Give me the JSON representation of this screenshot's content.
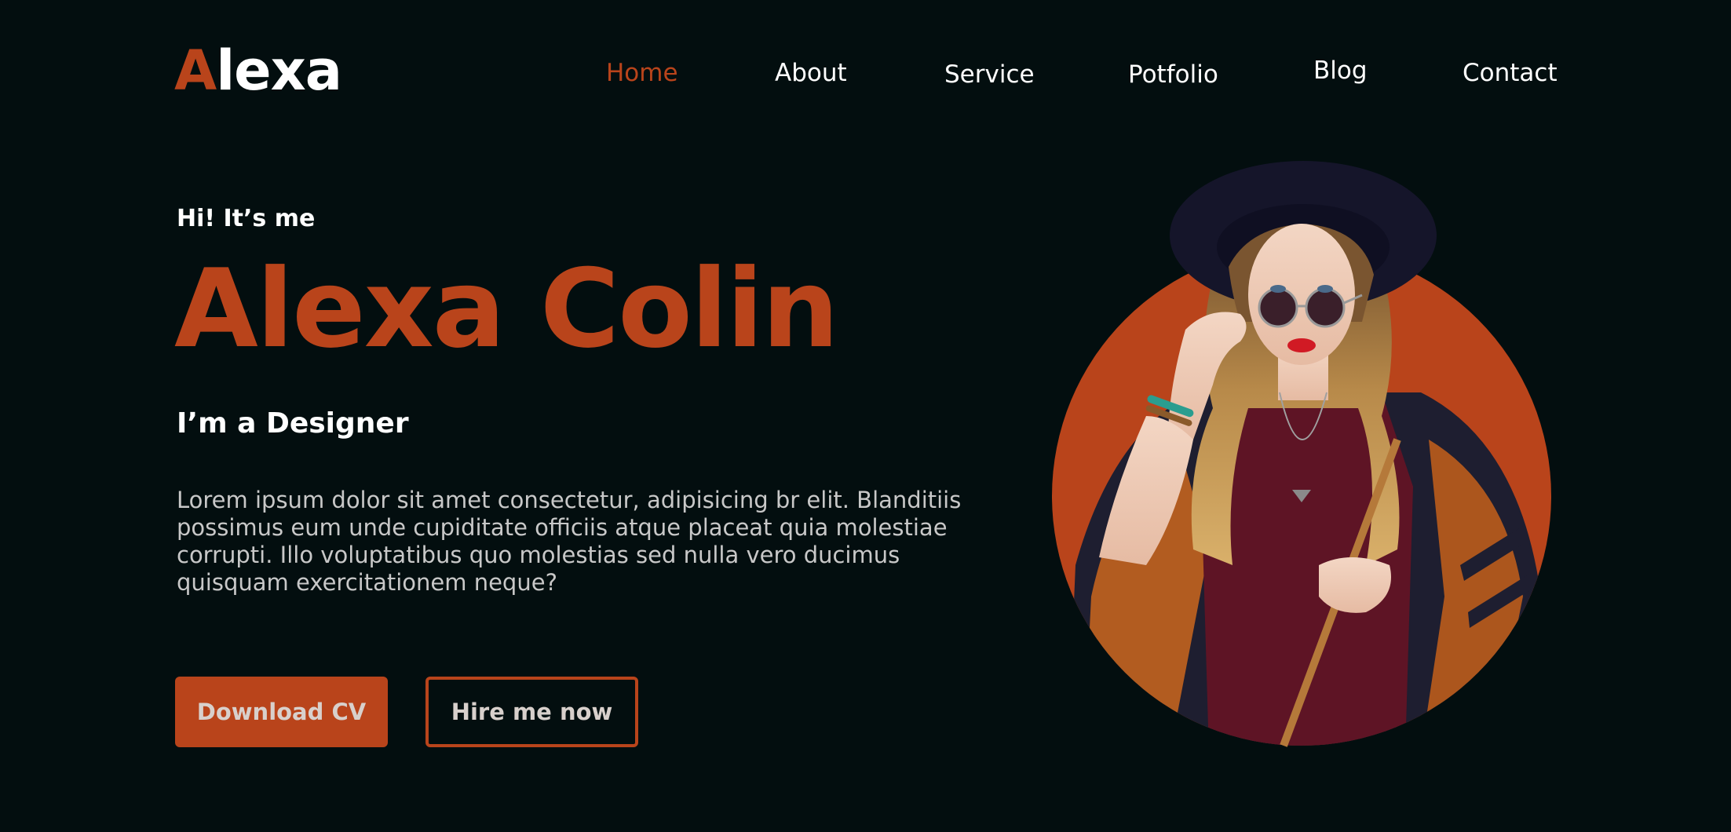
{
  "logo": {
    "accent_letter": "A",
    "rest": "lexa"
  },
  "nav": {
    "items": [
      {
        "label": "Home",
        "active": true
      },
      {
        "label": "About",
        "active": false
      },
      {
        "label": "Service",
        "active": false
      },
      {
        "label": "Potfolio",
        "active": false
      },
      {
        "label": "Blog",
        "active": false
      },
      {
        "label": "Contact",
        "active": false
      }
    ]
  },
  "hero": {
    "greeting": "Hi! It’s me",
    "name": "Alexa Colin",
    "role": "I’m a Designer",
    "description": "Lorem ipsum dolor sit amet consectetur, adipisicing br elit. Blanditiis possimus eum unde cupiditate officiis atque placeat quia molestiae corrupti. Illo voluptatibus quo molestias sed nulla vero ducimus quisquam exercitationem neque?",
    "download_button": "Download CV",
    "hire_button": "Hire me now"
  },
  "theme": {
    "background": "#030e0f",
    "accent": "#b9441b",
    "text": "#ffffff"
  }
}
